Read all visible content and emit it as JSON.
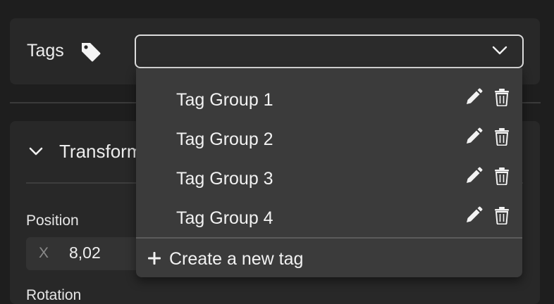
{
  "tags": {
    "label": "Tags",
    "select_value": ""
  },
  "transform": {
    "title": "Transform",
    "position_label": "Position",
    "x_label": "X",
    "x_value": "8,02",
    "rotation_label": "Rotation"
  },
  "dropdown": {
    "items": [
      {
        "label": "Tag Group 1"
      },
      {
        "label": "Tag Group 2"
      },
      {
        "label": "Tag Group 3"
      },
      {
        "label": "Tag Group 4"
      }
    ],
    "create_label": "Create a new tag"
  },
  "icons": {
    "tag": "tag-icon",
    "chevron": "chevron-down-icon",
    "edit": "pencil-icon",
    "delete": "trash-icon",
    "add": "plus-icon"
  },
  "colors": {
    "background": "#1e1e1e",
    "panel": "#282828",
    "dropdown": "#3b3b3b",
    "text": "#f2f2f2"
  }
}
